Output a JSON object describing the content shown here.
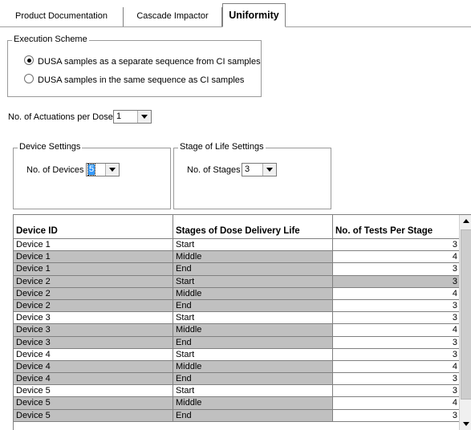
{
  "tabs": [
    {
      "label": "Product Documentation",
      "active": false
    },
    {
      "label": "Cascade Impactor",
      "active": false
    },
    {
      "label": "Uniformity",
      "active": true
    }
  ],
  "execution_scheme": {
    "legend": "Execution Scheme",
    "options": [
      {
        "label": "DUSA samples as a separate sequence from CI samples",
        "checked": true
      },
      {
        "label": "DUSA samples in the same sequence as CI samples",
        "checked": false
      }
    ]
  },
  "actuations": {
    "label": "No. of Actuations per Dose",
    "value": "1"
  },
  "device_settings": {
    "legend": "Device Settings",
    "label": "No. of Devices",
    "value": "5"
  },
  "stage_settings": {
    "legend": "Stage of Life Settings",
    "label": "No. of Stages",
    "value": "3"
  },
  "table": {
    "columns": [
      "Device ID",
      "Stages of Dose Delivery Life",
      "No. of Tests Per Stage"
    ],
    "rows": [
      {
        "device": "Device 1",
        "stage": "Start",
        "tests": "3",
        "shaded": false
      },
      {
        "device": "Device 1",
        "stage": "Middle",
        "tests": "4",
        "shaded": true
      },
      {
        "device": "Device 1",
        "stage": "End",
        "tests": "3",
        "shaded": true
      },
      {
        "device": "Device 2",
        "stage": "Start",
        "tests": "3",
        "shaded": true
      },
      {
        "device": "Device 2",
        "stage": "Middle",
        "tests": "4",
        "shaded": true
      },
      {
        "device": "Device 2",
        "stage": "End",
        "tests": "3",
        "shaded": true
      },
      {
        "device": "Device 3",
        "stage": "Start",
        "tests": "3",
        "shaded": false
      },
      {
        "device": "Device 3",
        "stage": "Middle",
        "tests": "4",
        "shaded": true
      },
      {
        "device": "Device 3",
        "stage": "End",
        "tests": "3",
        "shaded": true
      },
      {
        "device": "Device 4",
        "stage": "Start",
        "tests": "3",
        "shaded": false
      },
      {
        "device": "Device 4",
        "stage": "Middle",
        "tests": "4",
        "shaded": true
      },
      {
        "device": "Device 4",
        "stage": "End",
        "tests": "3",
        "shaded": true
      },
      {
        "device": "Device 5",
        "stage": "Start",
        "tests": "3",
        "shaded": false
      },
      {
        "device": "Device 5",
        "stage": "Middle",
        "tests": "4",
        "shaded": true
      },
      {
        "device": "Device 5",
        "stage": "End",
        "tests": "3",
        "shaded": true
      }
    ]
  },
  "colors": {
    "shaded_row": "#c0c0c0",
    "selection": "#3399ff"
  }
}
